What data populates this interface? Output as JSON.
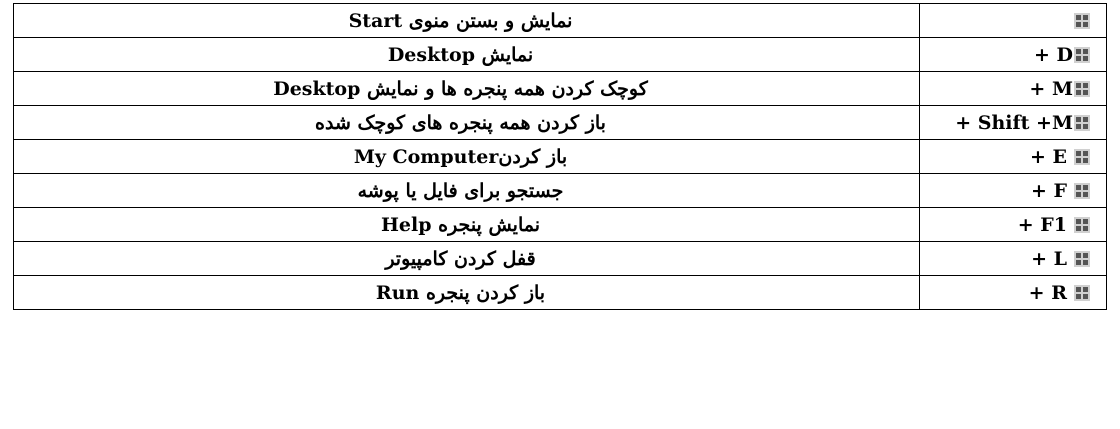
{
  "rows": [
    {
      "description": "نمایش و بستن منوی Start",
      "keys": ""
    },
    {
      "description": "نمایش Desktop",
      "keys": "+ D"
    },
    {
      "description": "کوچک کردن همه پنجره ها و نمایش Desktop",
      "keys": "+ M"
    },
    {
      "description": "باز کردن همه پنجره های کوچک شده",
      "keys": "+ Shift +M"
    },
    {
      "description": "باز کردنMy  Computer",
      "keys": "+ E"
    },
    {
      "description": "جستجو برای فایل یا پوشه",
      "keys": "+ F"
    },
    {
      "description": "نمایش پنجره Help",
      "keys": "+ F1"
    },
    {
      "description": "قفل کردن کامپیوتر",
      "keys": "+ L"
    },
    {
      "description": "باز کردن پنجره Run",
      "keys": "+ R"
    }
  ],
  "icon": "windows-logo-icon",
  "colors": {
    "border": "#000000",
    "icon_dark": "#5a5a5a",
    "icon_light": "#c8c8c8"
  }
}
